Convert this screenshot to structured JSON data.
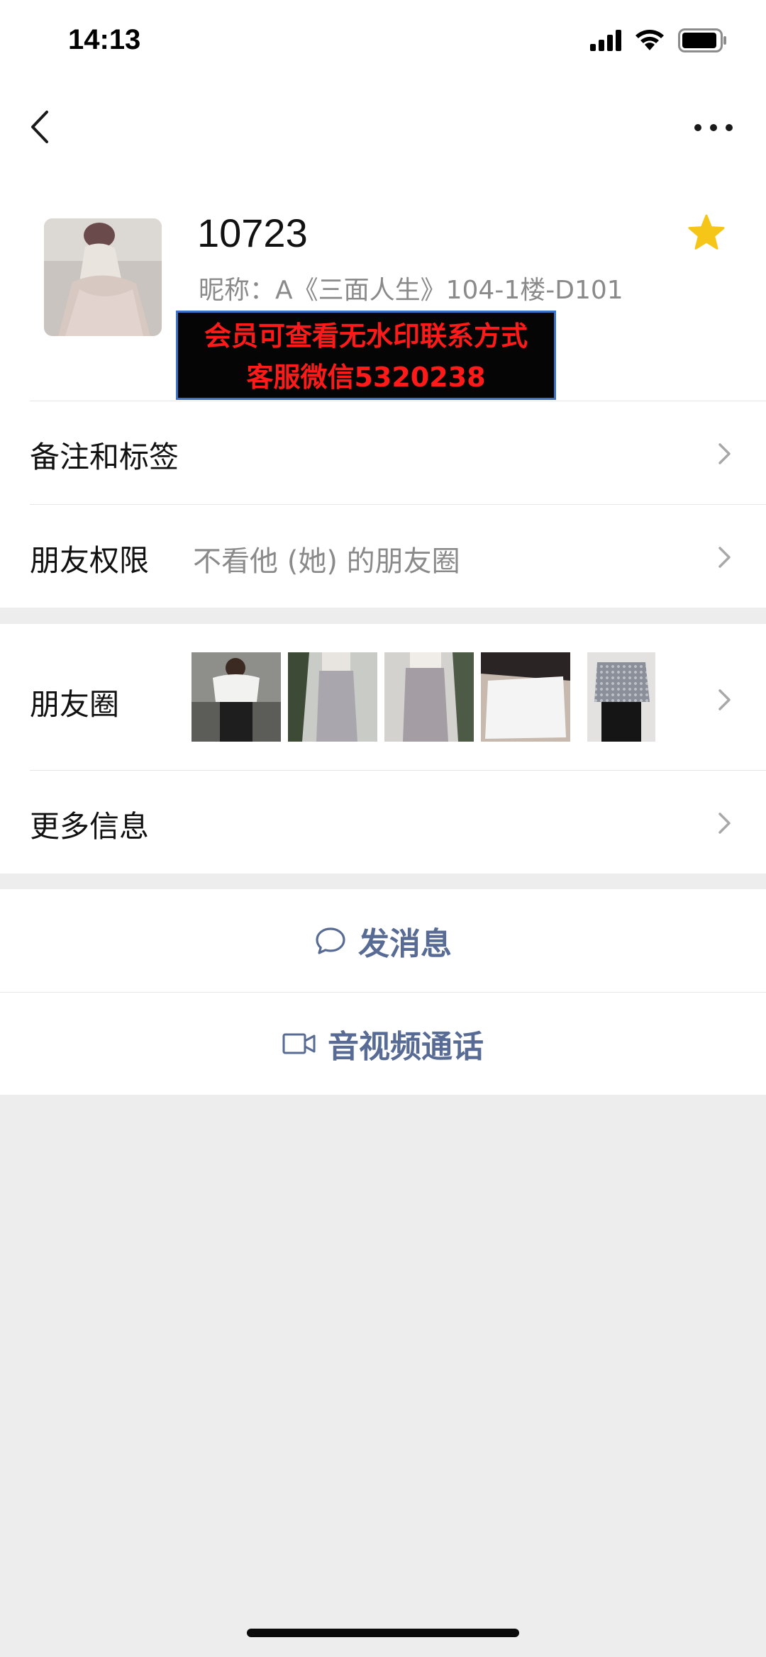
{
  "status_bar": {
    "time": "14:13"
  },
  "nav": {
    "back_icon": "chevron-left-icon",
    "more_icon": "more-dots-icon"
  },
  "profile": {
    "name": "10723",
    "nickname": "昵称：A《三面人生》104-1楼-D101",
    "starred": true,
    "star_color": "#f5c518",
    "overlay": {
      "line1": "会员可查看无水印联系方式",
      "line2": "客服微信5320238"
    }
  },
  "rows": {
    "remark": {
      "title": "备注和标签"
    },
    "permission": {
      "title": "朋友权限",
      "value": "不看他 (她) 的朋友圈"
    },
    "moments": {
      "title": "朋友圈",
      "thumb_count": 5
    },
    "more_info": {
      "title": "更多信息"
    }
  },
  "actions": {
    "message": {
      "label": "发消息",
      "icon": "chat-bubble-icon"
    },
    "call": {
      "label": "音视频通话",
      "icon": "video-camera-icon"
    }
  },
  "colors": {
    "link_blue": "#576b95",
    "overlay_text": "#ff1a1a",
    "background": "#ededed"
  }
}
